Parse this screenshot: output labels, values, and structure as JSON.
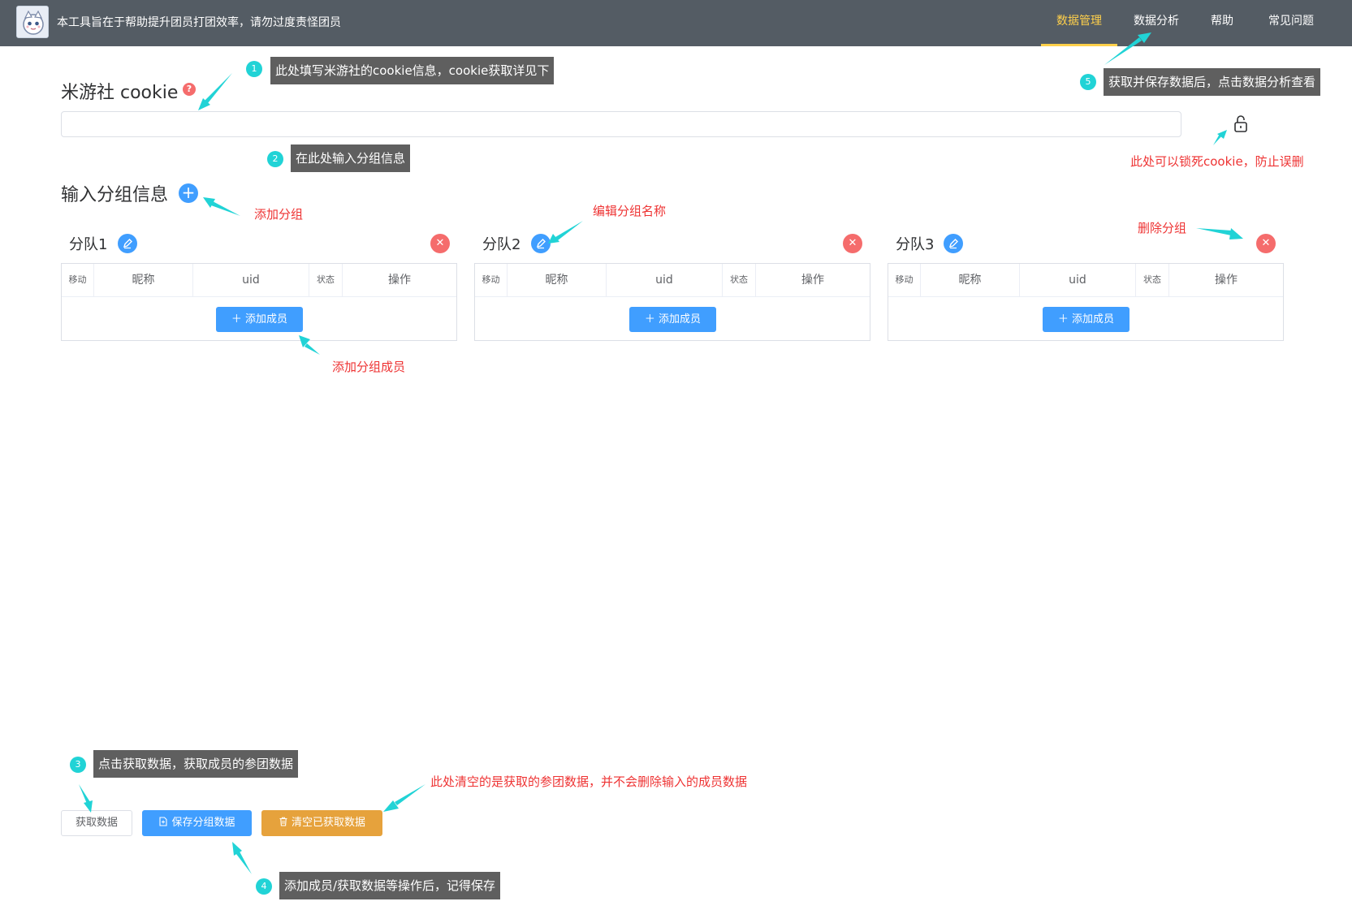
{
  "header": {
    "app_title": "本工具旨在于帮助提升团员打团效率，请勿过度责怪团员",
    "nav": [
      "数据管理",
      "数据分析",
      "帮助",
      "常见问题"
    ],
    "active_nav": "数据管理"
  },
  "cookie": {
    "label": "米游社 cookie",
    "help_glyph": "?",
    "value": "",
    "placeholder": ""
  },
  "groups_section": {
    "title": "输入分组信息",
    "add_glyph": "+",
    "groups": [
      {
        "name": "分队1"
      },
      {
        "name": "分队2"
      },
      {
        "name": "分队3"
      }
    ],
    "columns": [
      "移动",
      "昵称",
      "uid",
      "状态",
      "操作"
    ],
    "add_member_label": "＋ 添加成员",
    "delete_glyph": "✕"
  },
  "actions": {
    "fetch": "获取数据",
    "save": "保存分组数据",
    "clear": "清空已获取数据"
  },
  "annotations": {
    "tips": [
      {
        "num": "1",
        "text": "此处填写米游社的cookie信息，cookie获取详见下"
      },
      {
        "num": "2",
        "text": "在此处输入分组信息"
      },
      {
        "num": "3",
        "text": "点击获取数据，获取成员的参团数据"
      },
      {
        "num": "4",
        "text": "添加成员/获取数据等操作后，记得保存"
      },
      {
        "num": "5",
        "text": "获取并保存数据后，点击数据分析查看"
      }
    ],
    "notes": {
      "lock": "此处可以锁死cookie，防止误删",
      "add_group": "添加分组",
      "edit_group": "编辑分组名称",
      "delete_group": "删除分组",
      "add_member": "添加分组成员",
      "clear_note": "此处清空的是获取的参团数据，并不会删除输入的成员数据"
    }
  },
  "colors": {
    "topbar": "#545c64",
    "active_nav": "#ffd04b",
    "primary": "#409eff",
    "danger": "#f56c6c",
    "warning": "#e6a23c",
    "annotation_arrow": "#21d3d6",
    "annotation_text": "#ee3333"
  },
  "icons": {
    "avatar": "character-avatar-icon",
    "help": "question-circle-icon",
    "lock": "unlock-icon",
    "add_group": "plus-circle-icon",
    "edit": "pencil-icon",
    "delete": "close-circle-icon",
    "save": "document-icon",
    "clear": "trash-icon"
  }
}
